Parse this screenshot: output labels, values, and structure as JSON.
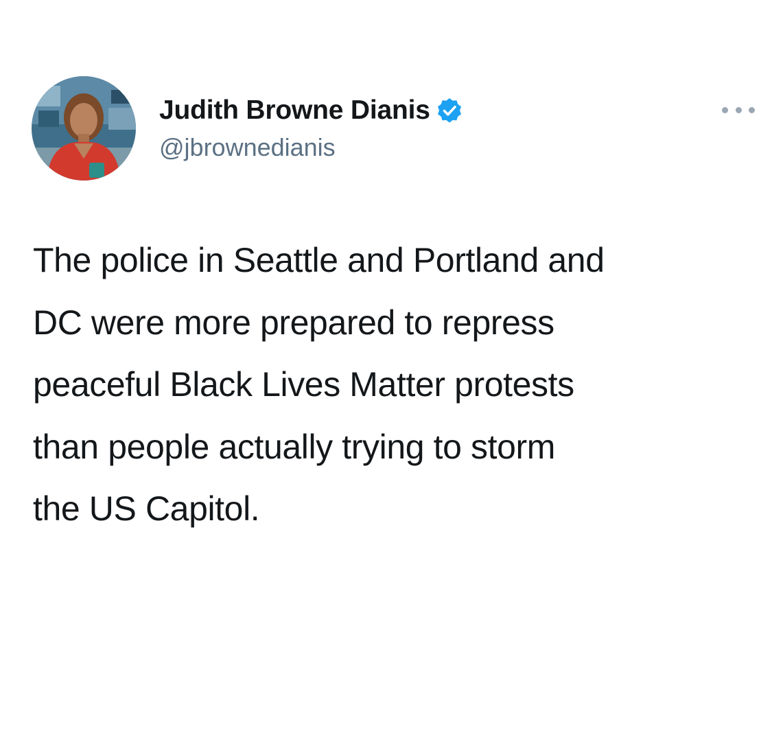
{
  "tweet": {
    "author": {
      "display_name": "Judith Browne Dianis",
      "handle": "@jbrownedianis",
      "verified": true,
      "avatar_icon": "profile-photo",
      "verified_icon": "verified-badge-icon"
    },
    "more_icon": "more-options-icon",
    "text_lines": [
      "The police in Seattle and Portland and",
      "DC were more prepared to repress",
      "peaceful Black Lives Matter protests",
      "than people actually trying to storm",
      "the US Capitol."
    ],
    "colors": {
      "name": "#14171a",
      "handle": "#5b7083",
      "verified": "#1da1f2",
      "background": "#ffffff"
    }
  }
}
